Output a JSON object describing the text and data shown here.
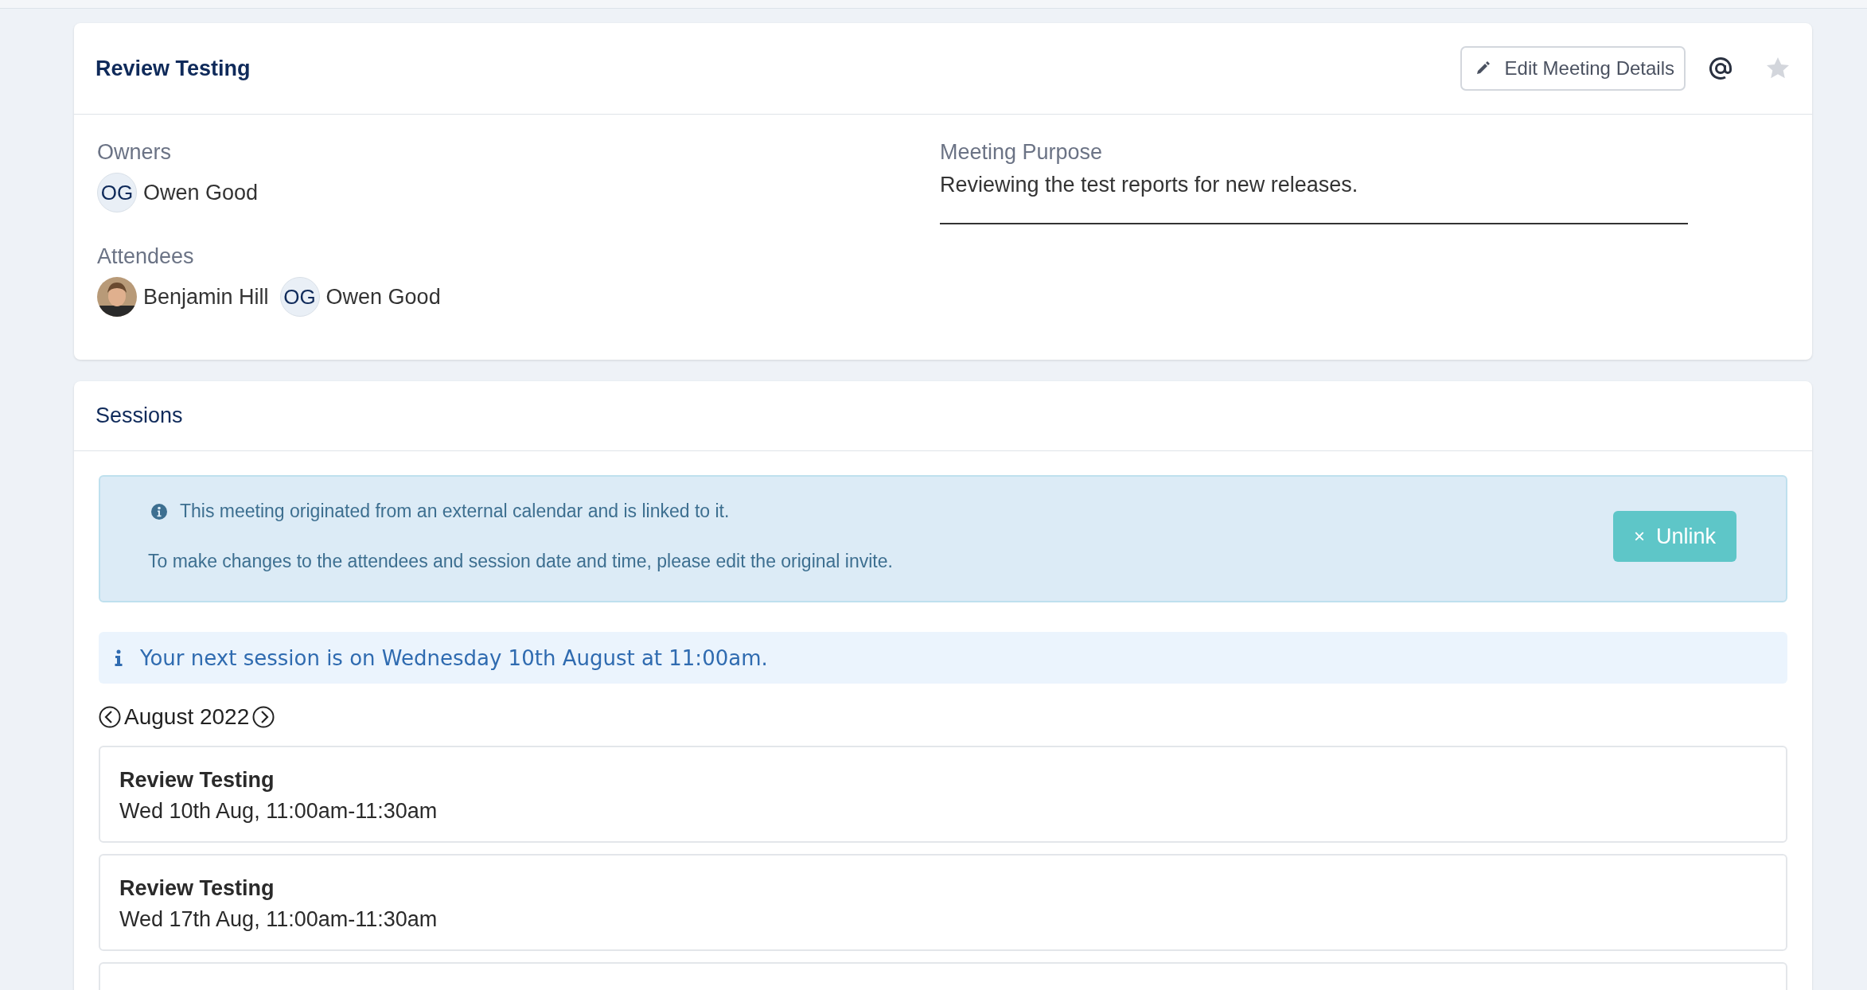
{
  "meeting": {
    "title": "Review Testing",
    "edit_button": "Edit Meeting Details",
    "starred": false,
    "owners_label": "Owners",
    "owners": [
      {
        "kind": "initials",
        "initials": "OG",
        "name": "Owen Good"
      }
    ],
    "attendees_label": "Attendees",
    "attendees": [
      {
        "kind": "picture",
        "name": "Benjamin Hill"
      },
      {
        "kind": "initials",
        "initials": "OG",
        "name": "Owen Good"
      }
    ],
    "purpose_label": "Meeting Purpose",
    "purpose": "Reviewing the test reports for new releases."
  },
  "sessions": {
    "title": "Sessions",
    "linked_notice": {
      "line_1": "This meeting originated from an external calendar and is linked to it.",
      "line_2": "To make changes to the attendees and session date and time, please edit the original invite.",
      "button": "Unlink",
      "button_icon": "×"
    },
    "next_session": "Your next session is on Wednesday 10th August at 11:00am.",
    "month": "August 2022",
    "items": [
      {
        "title": "Review Testing",
        "time": "Wed 10th Aug, 11:00am-11:30am"
      },
      {
        "title": "Review Testing",
        "time": "Wed 17th Aug, 11:00am-11:30am"
      }
    ]
  }
}
